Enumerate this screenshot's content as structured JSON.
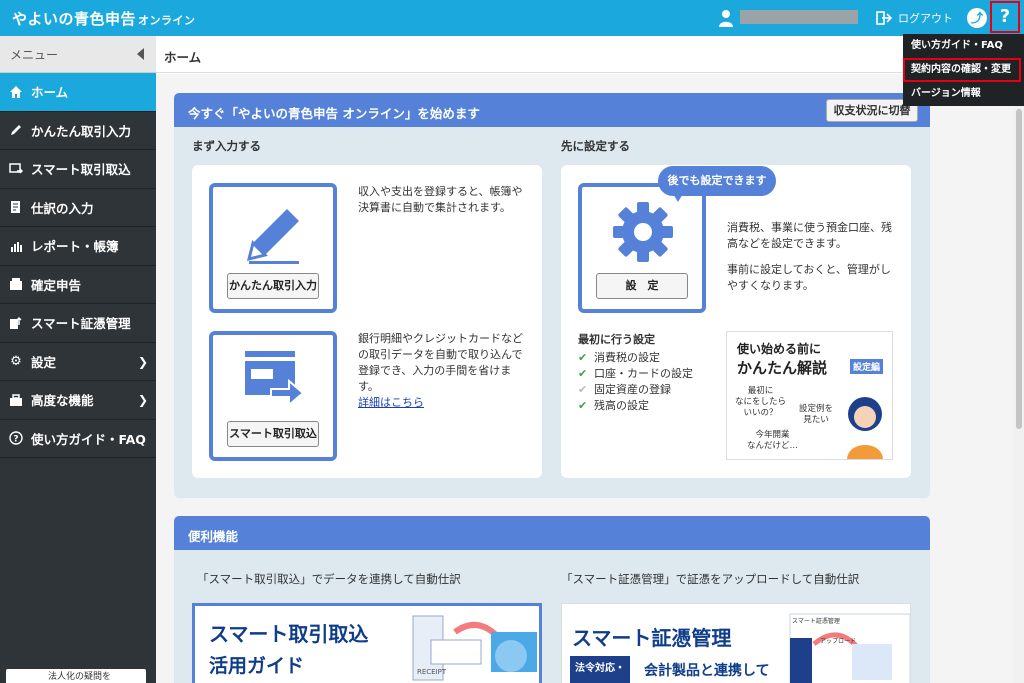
{
  "header": {
    "logo_main": "やよいの青色申告",
    "logo_sub": "オンライン",
    "logout": "ログアウト",
    "help": "?"
  },
  "help_menu": {
    "items": [
      "使い方ガイド・FAQ",
      "契約内容の確認・変更",
      "バージョン情報"
    ],
    "highlighted_index": 1
  },
  "sidebar": {
    "menu_label": "メニュー",
    "items": [
      {
        "label": "ホーム",
        "icon": "home-icon",
        "active": true
      },
      {
        "label": "かんたん取引入力",
        "icon": "pencil-icon"
      },
      {
        "label": "スマート取引取込",
        "icon": "import-icon"
      },
      {
        "label": "仕訳の入力",
        "icon": "journal-icon"
      },
      {
        "label": "レポート・帳簿",
        "icon": "report-icon"
      },
      {
        "label": "確定申告",
        "icon": "tax-return-icon"
      },
      {
        "label": "スマート証憑管理",
        "icon": "voucher-icon"
      },
      {
        "label": "設定",
        "icon": "gear-icon",
        "has_submenu": true
      },
      {
        "label": "高度な機能",
        "icon": "toolbox-icon",
        "has_submenu": true
      },
      {
        "label": "使い方ガイド・FAQ",
        "icon": "help-circle-icon"
      }
    ],
    "bottom_banner": "法人化の疑問を"
  },
  "breadcrumb": {
    "current": "ホーム"
  },
  "start_panel": {
    "title": "今すぐ「やよいの青色申告 オンライン」を始めます",
    "switch_button": "収支状況に切替",
    "input_section": {
      "title": "まず入力する",
      "tile1_button": "かんたん取引入力",
      "tile1_desc": [
        "収入や支出を登録すると、帳簿や",
        "決算書に自動で集計されます。"
      ],
      "tile2_button": "スマート取引取込",
      "tile2_desc": [
        "銀行明細やクレジットカードなど",
        "の取引データを自動で取り込んで",
        "登録でき、入力の手間を省けま",
        "す。"
      ],
      "tile2_link": "詳細はこちら"
    },
    "settings_section": {
      "title": "先に設定する",
      "bubble": "後でも設定できます",
      "button": "設　定",
      "desc1": [
        "消費税、事業に使う預金口座、残",
        "高などを設定できます。"
      ],
      "desc2": [
        "事前に設定しておくと、管理がし",
        "やすくなります。"
      ],
      "checklist_title": "最初に行う設定",
      "checklist": [
        {
          "label": "消費税の設定",
          "done": true
        },
        {
          "label": "口座・カードの設定",
          "done": true
        },
        {
          "label": "固定資産の登録",
          "done": false
        },
        {
          "label": "残高の設定",
          "done": true
        }
      ],
      "promo": {
        "line1": "使い始める前に",
        "line2": "かんたん解説",
        "tag": "設定編",
        "q1": "最初に\nなにをしたら\nいいの？",
        "q2": "設定例を\n見たい",
        "q3": "今年開業\nなんだけど…"
      }
    }
  },
  "features_panel": {
    "title": "便利機能",
    "left_caption": "「スマート取引取込」でデータを連携して自動仕訳",
    "right_caption": "「スマート証憑管理」で証憑をアップロードして自動仕訳",
    "left_card": {
      "title1": "スマート取引取込",
      "title2": "活用ガイド",
      "receipt": "RECEIPT"
    },
    "right_card": {
      "title": "スマート証憑管理",
      "badge": "法令対応・",
      "subtitle": "会計製品と連携して",
      "mini1": "スマート証憑管理",
      "mini2": "アップロード"
    }
  },
  "colors": {
    "accent": "#1aa8dd",
    "panel_head": "#5582d8",
    "sidebar": "#2f3438",
    "highlight": "#e60012"
  }
}
